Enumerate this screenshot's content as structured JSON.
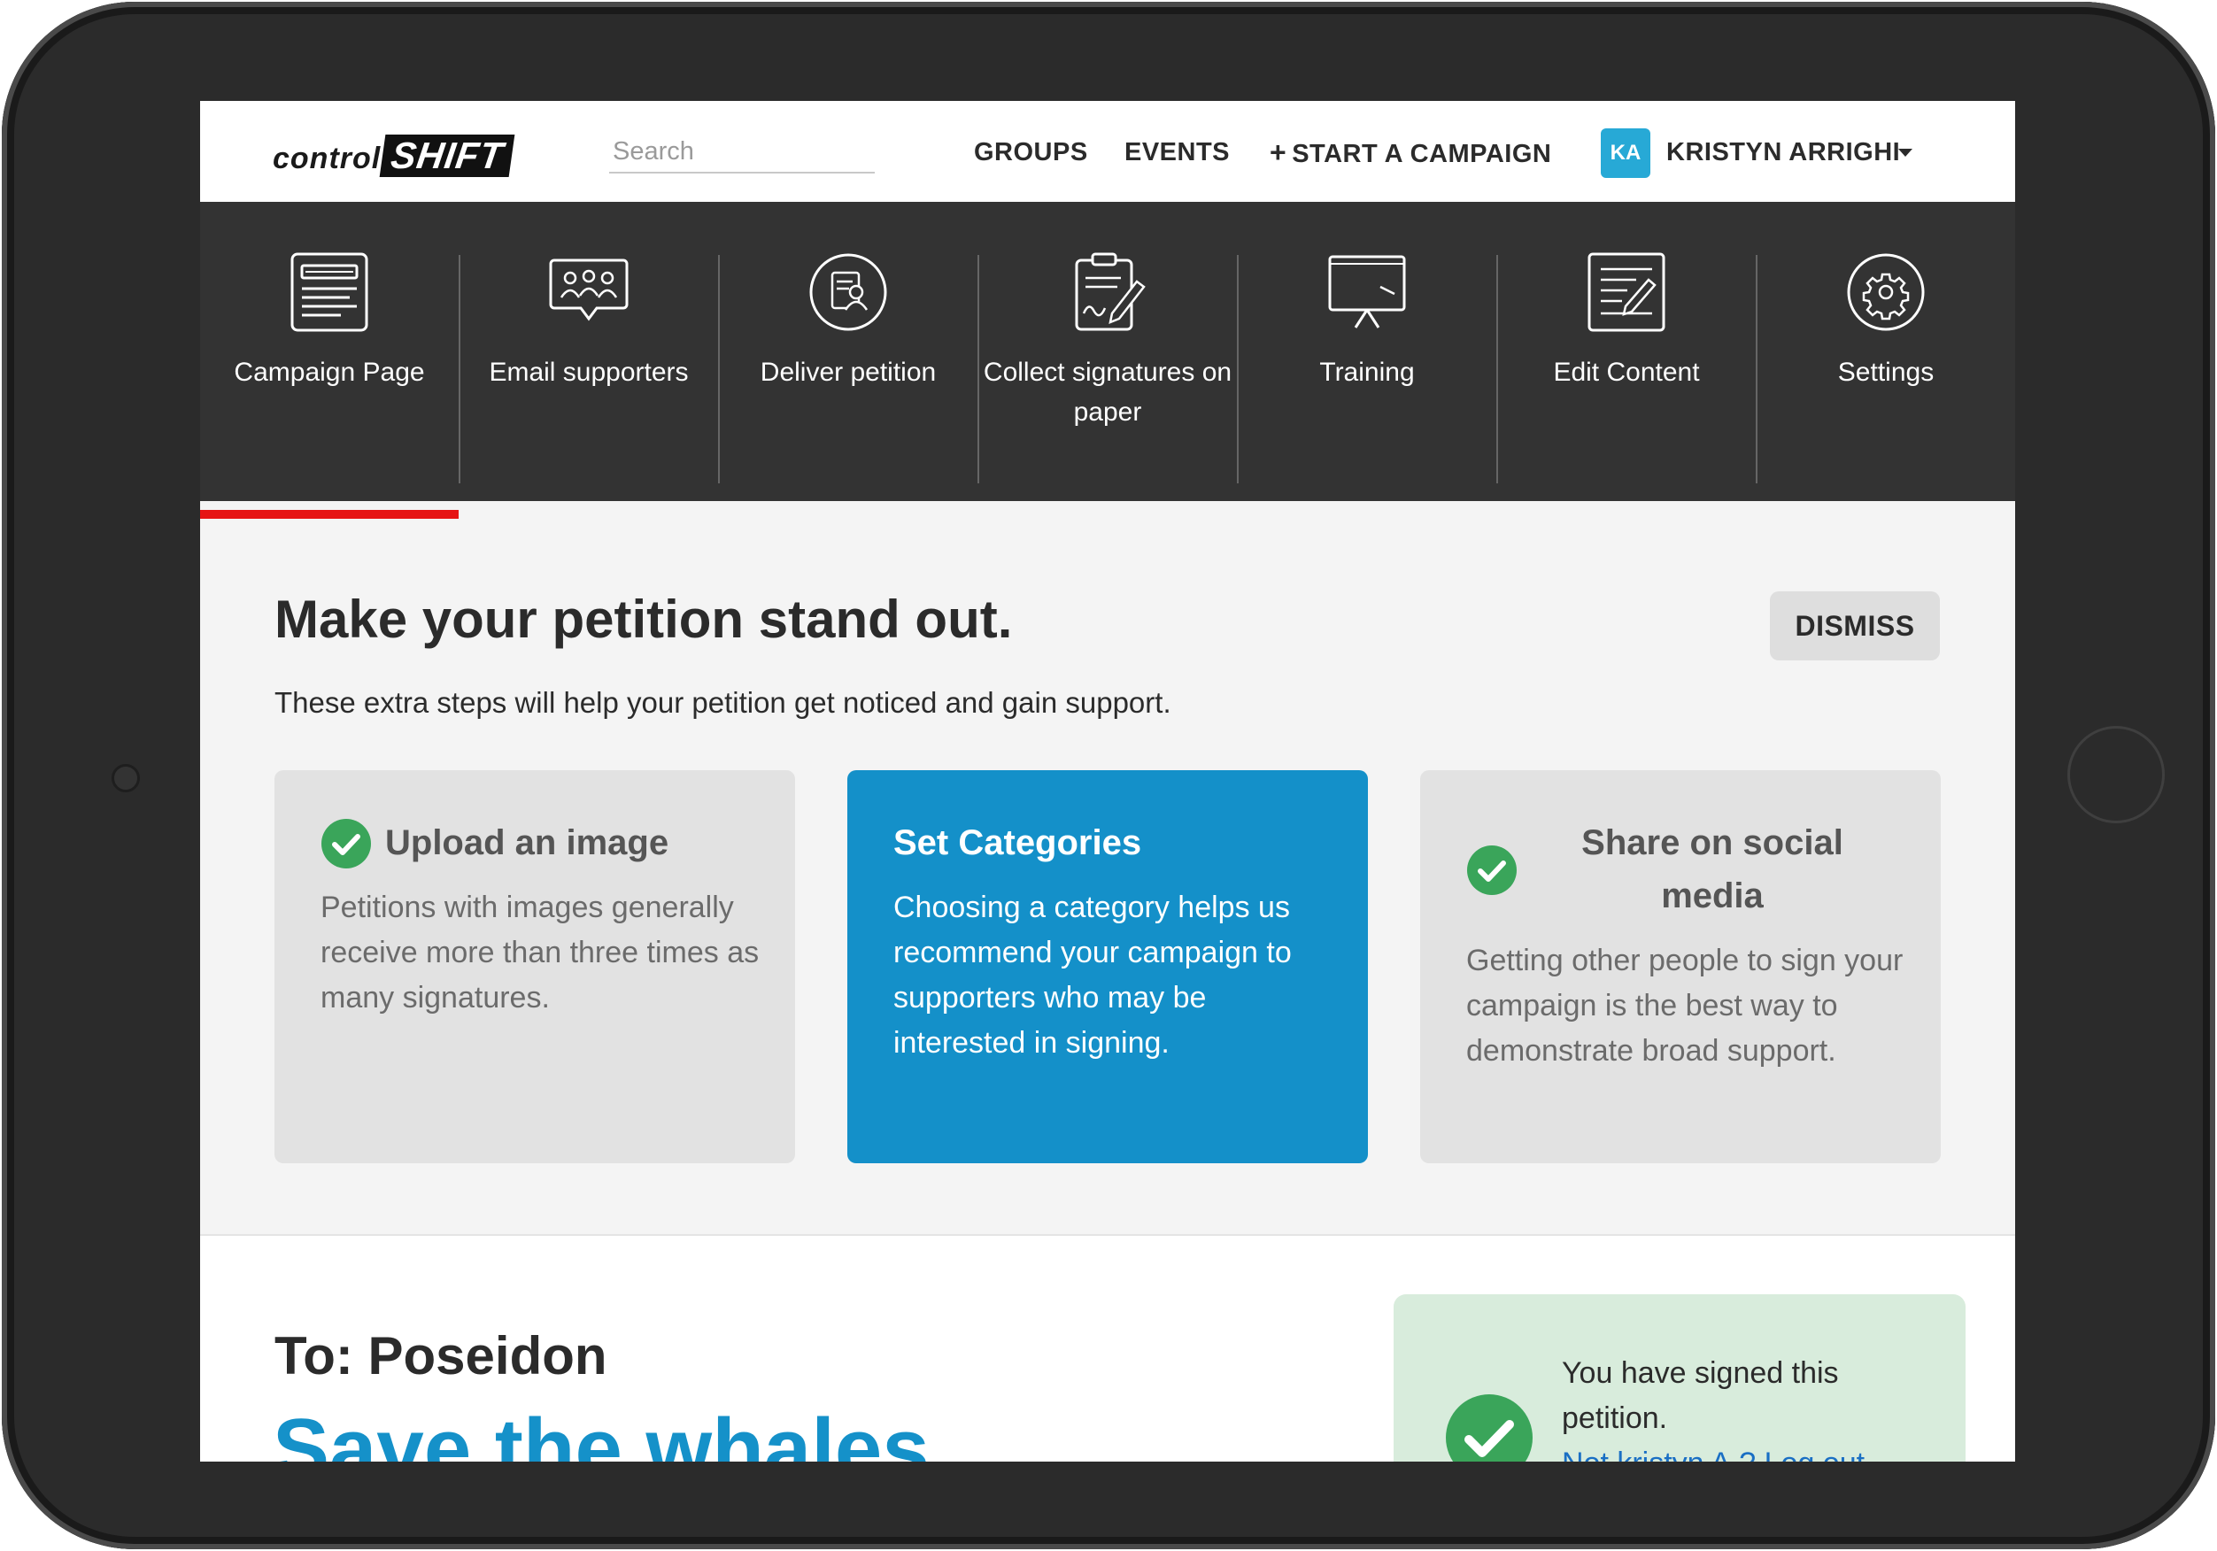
{
  "brand": {
    "logo_left": "control",
    "logo_right": "SHIFT"
  },
  "search": {
    "placeholder": "Search"
  },
  "nav": {
    "groups": "GROUPS",
    "events": "EVENTS",
    "start_campaign": "START A CAMPAIGN",
    "user_initials": "KA",
    "user_name": "KRISTYN ARRIGHI"
  },
  "tools": [
    {
      "label": "Campaign Page",
      "icon": "document-page-icon",
      "active": true
    },
    {
      "label": "Email supporters",
      "icon": "people-speech-icon"
    },
    {
      "label": "Deliver petition",
      "icon": "person-document-icon"
    },
    {
      "label": "Collect signatures on paper",
      "icon": "clipboard-pen-icon"
    },
    {
      "label": "Training",
      "icon": "presentation-board-icon"
    },
    {
      "label": "Edit Content",
      "icon": "edit-document-icon"
    },
    {
      "label": "Settings",
      "icon": "gear-icon"
    }
  ],
  "promo": {
    "title": "Make your petition stand out.",
    "subtitle": "These extra steps will help your petition get noticed and gain support.",
    "dismiss": "DISMISS",
    "cards": [
      {
        "title": "Upload an image",
        "body": "Petitions with images generally receive more than three times as many signatures.",
        "completed": true
      },
      {
        "title": "Set Categories",
        "body": "Choosing a category helps us recommend your campaign to supporters who may be interested in signing.",
        "completed": false
      },
      {
        "title": "Share on social media",
        "body": "Getting other people to sign your campaign is the best way to demonstrate broad support.",
        "completed": true
      }
    ]
  },
  "petition": {
    "to": "To: Poseidon",
    "title": "Save the whales",
    "signed_text": "You have signed this petition.",
    "signed_link": "Not kristyn A.? Log out"
  },
  "colors": {
    "accent_blue": "#1490c9",
    "active_red": "#e61515",
    "success_green": "#3aa55a",
    "toolbar_bg": "#333333"
  }
}
